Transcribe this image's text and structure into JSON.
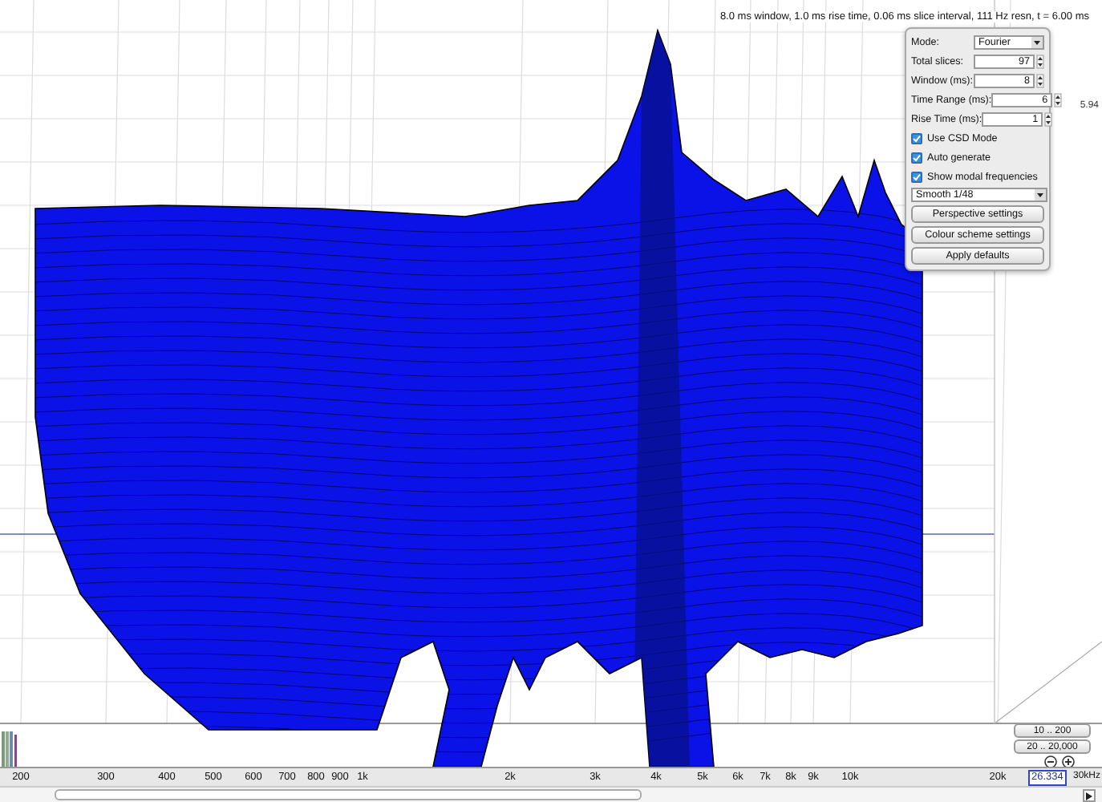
{
  "status_text": "8.0 ms window, 1.0 ms rise time, 0.06 ms slice interval, 111 Hz resn, t = 6.00 ms",
  "side_label": "5.94",
  "settings_panel": {
    "mode": {
      "label": "Mode:",
      "value": "Fourier"
    },
    "fields": [
      {
        "label": "Total slices:",
        "value": "97"
      },
      {
        "label": "Window (ms):",
        "value": "8"
      },
      {
        "label": "Time Range (ms):",
        "value": "6"
      },
      {
        "label": "Rise Time (ms):",
        "value": "1"
      }
    ],
    "checkboxes": [
      {
        "label": "Use CSD Mode",
        "checked": true
      },
      {
        "label": "Auto generate",
        "checked": true
      },
      {
        "label": "Show modal frequencies",
        "checked": true
      }
    ],
    "smoothing": "Smooth 1/48",
    "buttons": [
      "Perspective settings",
      "Colour scheme settings",
      "Apply defaults"
    ]
  },
  "range_buttons": [
    "10 .. 200",
    "20 .. 20,000"
  ],
  "x_axis": {
    "ticks": [
      "200",
      "300",
      "400",
      "500",
      "600",
      "700",
      "800",
      "900",
      "1k",
      "2k",
      "3k",
      "4k",
      "5k",
      "6k",
      "7k",
      "8k",
      "9k",
      "10k",
      "20k"
    ],
    "cursor_value": "26.334",
    "unit_label": "30kHz"
  }
}
